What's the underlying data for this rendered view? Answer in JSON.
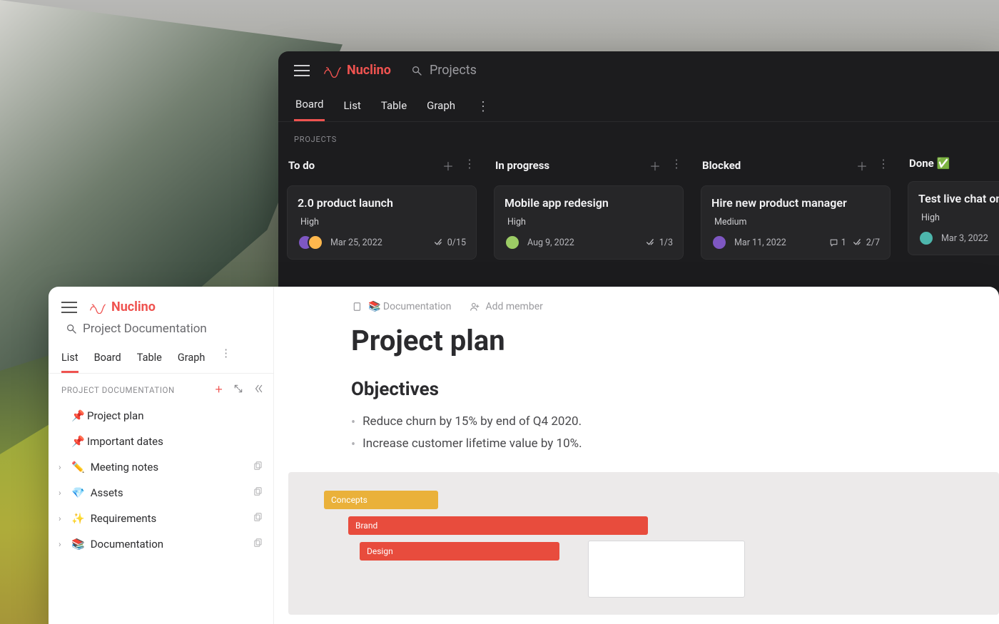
{
  "brand": "Nuclino",
  "dark": {
    "search_placeholder": "Projects",
    "tabs": [
      "Board",
      "List",
      "Table",
      "Graph"
    ],
    "active_tab": "Board",
    "section_label": "PROJECTS",
    "columns": [
      {
        "title": "To do",
        "cards": [
          {
            "title": "2.0 product launch",
            "priority": "High",
            "date": "Mar 25, 2022",
            "checks": "0/15",
            "avatars": 2
          }
        ]
      },
      {
        "title": "In progress",
        "cards": [
          {
            "title": "Mobile app redesign",
            "priority": "High",
            "date": "Aug 9, 2022",
            "checks": "1/3",
            "avatars": 1
          }
        ]
      },
      {
        "title": "Blocked",
        "cards": [
          {
            "title": "Hire new product manager",
            "priority": "Medium",
            "date": "Mar 11, 2022",
            "checks": "2/7",
            "comments": "1",
            "avatars": 1
          }
        ]
      },
      {
        "title": "Done ✅",
        "cards": [
          {
            "title": "Test live chat on the w",
            "priority": "High",
            "date": "Mar 3, 2022",
            "avatars": 1
          }
        ]
      }
    ]
  },
  "light": {
    "search_placeholder": "Project Documentation",
    "tabs": [
      "List",
      "Board",
      "Table",
      "Graph"
    ],
    "active_tab": "List",
    "section_label": "PROJECT DOCUMENTATION",
    "tree": [
      {
        "icon": "pin",
        "label": "Project plan",
        "expandable": false
      },
      {
        "icon": "pin",
        "label": "Important dates",
        "expandable": false
      },
      {
        "icon": "✏️",
        "label": "Meeting notes",
        "expandable": true
      },
      {
        "icon": "💎",
        "label": "Assets",
        "expandable": true
      },
      {
        "icon": "✨",
        "label": "Requirements",
        "expandable": true
      },
      {
        "icon": "📚",
        "label": "Documentation",
        "expandable": true
      }
    ],
    "doc": {
      "breadcrumb": "📚 Documentation",
      "add_member": "Add member",
      "title": "Project plan",
      "section_heading": "Objectives",
      "bullets": [
        "Reduce churn by 15% by end of Q4 2020.",
        "Increase customer lifetime value by 10%."
      ],
      "gantt": {
        "bars": [
          "Concepts",
          "Brand",
          "Design"
        ]
      }
    }
  }
}
